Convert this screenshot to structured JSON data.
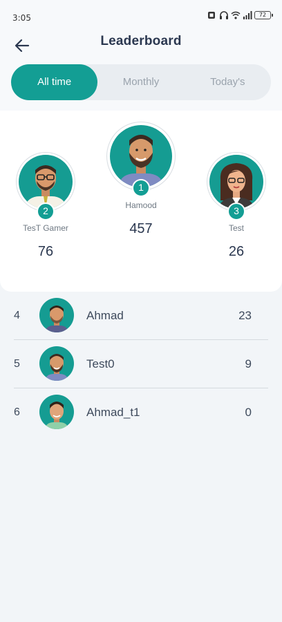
{
  "status_bar": {
    "time": "3:05",
    "battery": "72",
    "icons": [
      "notification-icon",
      "headphones-icon",
      "wifi-icon",
      "signal-icon",
      "battery-icon"
    ]
  },
  "header": {
    "title": "Leaderboard",
    "back_icon": "arrow-left-icon"
  },
  "tabs": [
    {
      "label": "All time",
      "active": true
    },
    {
      "label": "Monthly",
      "active": false
    },
    {
      "label": "Today's",
      "active": false
    }
  ],
  "podium": {
    "first": {
      "rank": "1",
      "name": "Hamood",
      "score": "457"
    },
    "second": {
      "rank": "2",
      "name": "TesT Gamer",
      "score": "76"
    },
    "third": {
      "rank": "3",
      "name": "Test",
      "score": "26"
    }
  },
  "list": [
    {
      "rank": "4",
      "name": "Ahmad",
      "score": "23"
    },
    {
      "rank": "5",
      "name": "Test0",
      "score": "9"
    },
    {
      "rank": "6",
      "name": "Ahmad_t1",
      "score": "0"
    }
  ],
  "colors": {
    "accent": "#139e94",
    "avatar_bg": "#159c92",
    "text_dark": "#2b3850",
    "text_muted": "#9aa3ad",
    "page_bg": "#f2f5f8"
  }
}
